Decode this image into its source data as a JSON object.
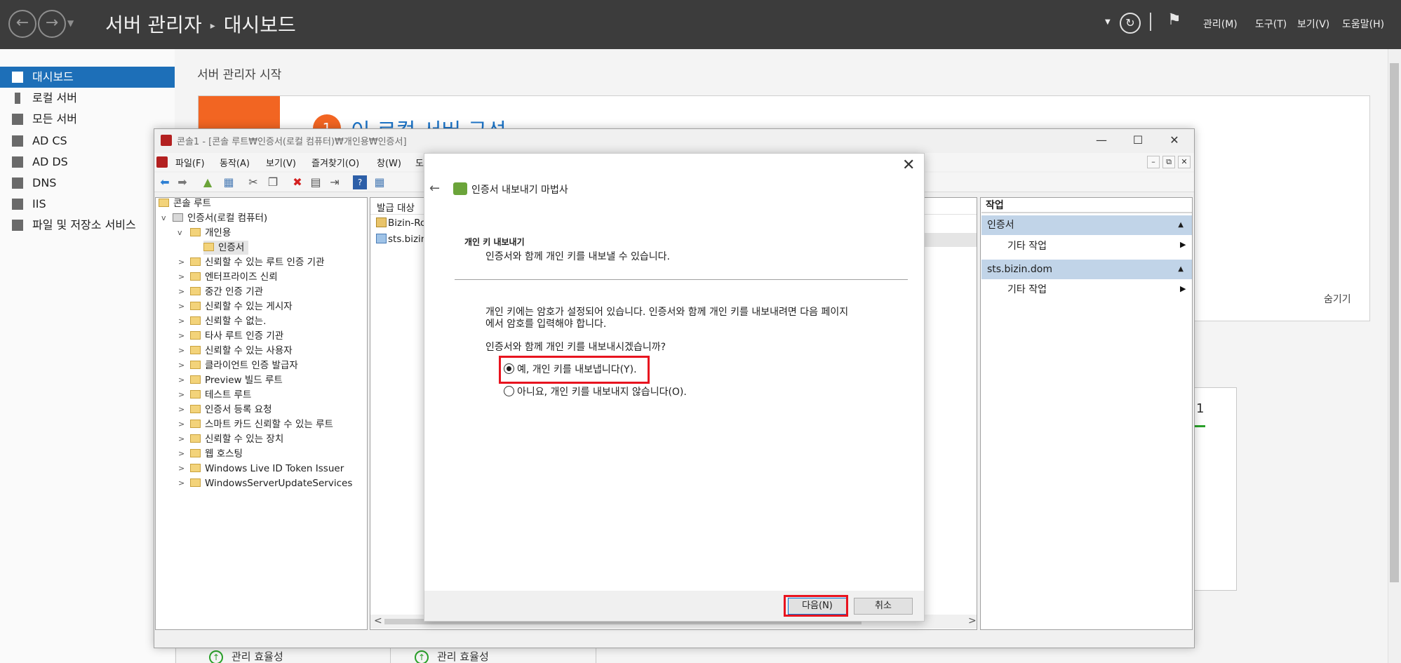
{
  "server_manager": {
    "title_root": "서버 관리자",
    "title_page": "대시보드",
    "header_menus": [
      "관리(M)",
      "도구(T)",
      "보기(V)",
      "도움말(H)"
    ],
    "nav": [
      {
        "label": "대시보드",
        "icon": "dashboard-icon",
        "selected": true
      },
      {
        "label": "로컬 서버",
        "icon": "server-icon"
      },
      {
        "label": "모든 서버",
        "icon": "servers-icon"
      },
      {
        "label": "AD CS",
        "icon": "adcs-icon"
      },
      {
        "label": "AD DS",
        "icon": "adds-icon"
      },
      {
        "label": "DNS",
        "icon": "dns-icon"
      },
      {
        "label": "IIS",
        "icon": "iis-icon"
      },
      {
        "label": "파일 및 저장소 서비스",
        "icon": "file-storage-icon"
      }
    ],
    "quick_start_heading": "서버 관리자 시작",
    "quick_start_step_number": "1",
    "quick_start_link": "이 로컬 서버 구성",
    "hide_label": "숨기기",
    "tile_count": "1",
    "manageability_label": "관리 효율성"
  },
  "mmc": {
    "title": "콘솔1 - [콘솔 루트₩인증서(로컬 컴퓨터)₩개인용₩인증서]",
    "menus": [
      "파일(F)",
      "동작(A)",
      "보기(V)",
      "즐겨찾기(O)",
      "창(W)",
      "도"
    ],
    "tree": {
      "root": "콘솔 루트",
      "store": "인증서(로컬 컴퓨터)",
      "personal": "개인용",
      "certificates": "인증서",
      "folders": [
        "신뢰할 수 있는 루트 인증 기관",
        "엔터프라이즈 신뢰",
        "중간 인증 기관",
        "신뢰할 수 있는 게시자",
        "신뢰할 수 없는.",
        "타사 루트 인증 기관",
        "신뢰할 수 있는 사용자",
        "클라이언트 인증 발급자",
        "Preview 빌드 루트",
        "테스트 루트",
        "인증서 등록 요청",
        "스마트 카드 신뢰할 수 있는 루트",
        "신뢰할 수 있는 장치",
        "웹 호스팅",
        "Windows Live ID Token Issuer",
        "WindowsServerUpdateServices"
      ]
    },
    "list": {
      "header": "발급 대상",
      "rows": [
        "Bizin-Ro",
        "sts.bizin"
      ]
    },
    "actions": {
      "header": "작업",
      "groups": [
        {
          "title": "인증서",
          "item": "기타 작업"
        },
        {
          "title": "sts.bizin.dom",
          "item": "기타 작업"
        }
      ]
    }
  },
  "wizard": {
    "title": "인증서 내보내기 마법사",
    "section_heading": "개인 키 내보내기",
    "section_subtitle": "인증서와 함께 개인 키를 내보낼 수 있습니다.",
    "body_line1": "개인 키에는 암호가 설정되어 있습니다. 인증서와 함께 개인 키를 내보내려면 다음 페이지",
    "body_line2": "에서 암호를 입력해야 합니다.",
    "question": "인증서와 함께 개인 키를 내보내시겠습니까?",
    "option_yes": "예, 개인 키를 내보냅니다(Y).",
    "option_no": "아니요, 개인 키를 내보내지 않습니다(O).",
    "selected_option": "yes",
    "next_button": "다음(N)",
    "cancel_button": "취소"
  },
  "colors": {
    "accent": "#1d6fb8",
    "quick_start": "#f26522",
    "highlight": "#e8141f",
    "action_group": "#c1d4e8"
  }
}
